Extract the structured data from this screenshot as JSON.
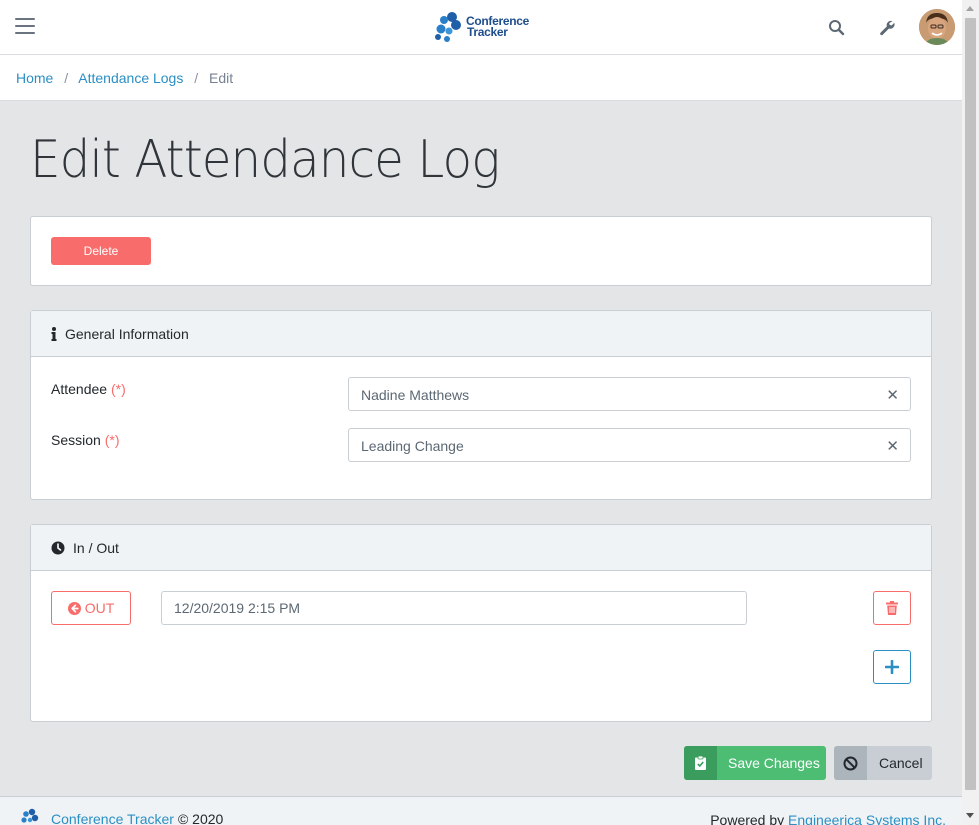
{
  "app": {
    "logo_line1": "Conference",
    "logo_line2": "Tracker"
  },
  "breadcrumb": {
    "home": "Home",
    "logs": "Attendance Logs",
    "current": "Edit",
    "separator": "/"
  },
  "page": {
    "title": "Edit Attendance Log",
    "delete_label": "Delete"
  },
  "general": {
    "header": "General Information",
    "attendee_label": "Attendee",
    "attendee_value": "Nadine Matthews",
    "session_label": "Session",
    "session_value": "Leading Change",
    "required_mark": "(*)",
    "clear_glyph": "✕"
  },
  "inout": {
    "header": "In / Out",
    "direction_label": "OUT",
    "time_value": "12/20/2019 2:15 PM"
  },
  "actions": {
    "save_label": "Save Changes",
    "cancel_label": "Cancel"
  },
  "footer": {
    "app_link": "Conference Tracker",
    "copyright": "© 2020",
    "powered_by": "Powered by",
    "company_link": "Engineerica Systems Inc."
  },
  "colors": {
    "primary": "#2b8fc4",
    "danger": "#f86c6b",
    "success": "#4dbd74",
    "secondary": "#c8ced3"
  },
  "icons": {
    "menu": "hamburger-icon",
    "search": "search-icon",
    "settings": "wrench-icon",
    "info": "info-icon",
    "clock": "clock-icon",
    "out": "arrow-circle-left-icon",
    "trash": "trash-icon",
    "add": "plus-icon",
    "save": "clipboard-check-icon",
    "cancel": "ban-icon"
  }
}
